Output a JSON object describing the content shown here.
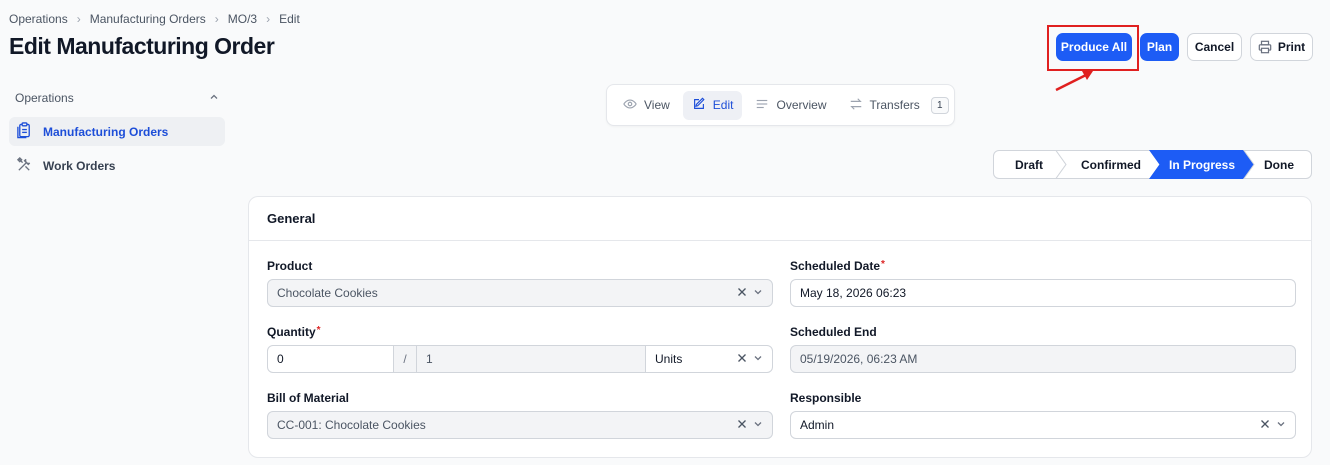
{
  "breadcrumb": [
    "Operations",
    "Manufacturing Orders",
    "MO/3",
    "Edit"
  ],
  "page_title": "Edit Manufacturing Order",
  "actions": {
    "produce_all": "Produce All",
    "plan": "Plan",
    "cancel": "Cancel",
    "print": "Print"
  },
  "sidebar": {
    "group_label": "Operations",
    "items": [
      {
        "label": "Manufacturing Orders",
        "icon": "clipboard-icon",
        "active": true
      },
      {
        "label": "Work Orders",
        "icon": "tools-icon",
        "active": false
      }
    ]
  },
  "tabs": [
    {
      "label": "View",
      "icon": "eye-icon"
    },
    {
      "label": "Edit",
      "icon": "pencil-icon",
      "active": true
    },
    {
      "label": "Overview",
      "icon": "lines-icon"
    },
    {
      "label": "Transfers",
      "icon": "arrows-icon",
      "badge": "1"
    }
  ],
  "stages": [
    "Draft",
    "Confirmed",
    "In Progress",
    "Done"
  ],
  "current_stage": "In Progress",
  "form": {
    "section_title": "General",
    "product": {
      "label": "Product",
      "value": "Chocolate Cookies"
    },
    "quantity": {
      "label": "Quantity",
      "value": "0",
      "separator": "/",
      "planned": "1",
      "unit": "Units"
    },
    "bom": {
      "label": "Bill of Material",
      "value": "CC-001: Chocolate Cookies"
    },
    "scheduled_date": {
      "label": "Scheduled Date",
      "value": "May 18, 2026 06:23"
    },
    "scheduled_end": {
      "label": "Scheduled End",
      "value": "05/19/2026, 06:23 AM"
    },
    "responsible": {
      "label": "Responsible",
      "value": "Admin"
    },
    "required_mark": "*"
  },
  "colors": {
    "primary": "#1d5cf5",
    "highlight": "#e02020"
  }
}
